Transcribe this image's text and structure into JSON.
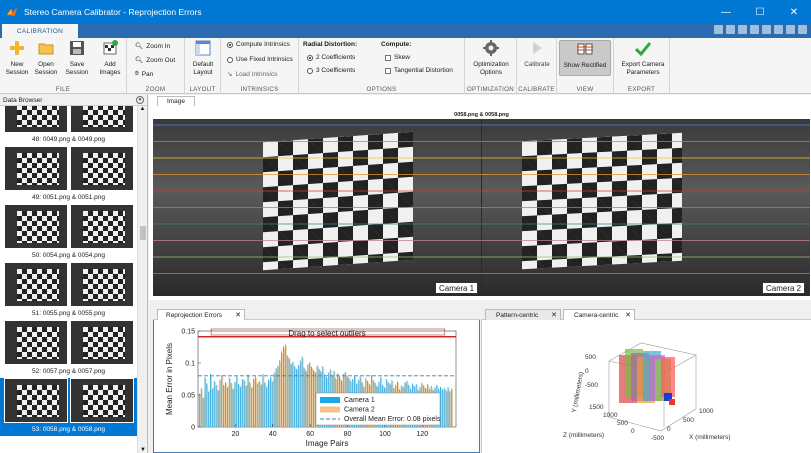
{
  "window": {
    "title": "Stereo Camera Calibrator - Reprojection Errors",
    "min": "—",
    "max": "☐",
    "close": "✕"
  },
  "ribbon_tab": "CALIBRATION",
  "file": {
    "new": "New Session",
    "open": "Open Session",
    "save": "Save Session",
    "add": "Add Images",
    "label": "FILE"
  },
  "zoom": {
    "in": "Zoom In",
    "out": "Zoom Out",
    "pan": "Pan",
    "label": "ZOOM"
  },
  "layout": {
    "default": "Default Layout",
    "label": "LAYOUT"
  },
  "intrinsics": {
    "compute": "Compute Intrinsics",
    "fixed": "Use Fixed Intrinsics",
    "load": "Load Intrinsics",
    "label": "INTRINSICS"
  },
  "options": {
    "radial": "Radial Distortion:",
    "c2": "2 Coefficients",
    "c3": "3 Coefficients",
    "compute": "Compute:",
    "skew": "Skew",
    "tangential": "Tangential Distortion",
    "label": "OPTIONS"
  },
  "optimization": {
    "btn": "Optimization Options",
    "label": "OPTIMIZATION"
  },
  "calibrate": {
    "btn": "Calibrate",
    "label": "CALIBRATE"
  },
  "view": {
    "btn": "Show Rectified",
    "label": "VIEW"
  },
  "export": {
    "btn": "Export Camera Parameters",
    "label": "EXPORT"
  },
  "data_browser": {
    "title": "Data Browser",
    "items": [
      "48: 0049.png & 0049.png",
      "49: 0051.png & 0051.png",
      "50: 0054.png & 0054.png",
      "51: 0055.png & 0055.png",
      "52: 0057.png & 0057.png",
      "53: 0058.png & 0058.png"
    ],
    "selected_index": 5
  },
  "image_view": {
    "tab": "Image",
    "pair_title": "0058.png & 0058.png",
    "cam1": "Camera 1",
    "cam2": "Camera 2"
  },
  "errors_tab": "Reprojection Errors",
  "right_tabs": [
    "Pattern-centric",
    "Camera-centric"
  ],
  "chart_data": {
    "type": "bar",
    "title": "",
    "drag_hint": "Drag to select outliers",
    "xlabel": "Image Pairs",
    "ylabel": "Mean Error in Pixels",
    "ylim": [
      0,
      0.15
    ],
    "xlim": [
      0,
      138
    ],
    "yticks": [
      "0",
      "0.05",
      "0.1",
      "0.15"
    ],
    "xticks": [
      "20",
      "40",
      "60",
      "80",
      "100",
      "120"
    ],
    "overall_mean": 0.08,
    "legend": [
      "Camera 1",
      "Camera 2",
      "Overall Mean Error: 0.08 pixels"
    ],
    "colors": {
      "camera1": "#1ea7e8",
      "camera2": "#f2c48c",
      "mean": "#3a7fb8",
      "outlier": "#d62728"
    },
    "outlier_threshold": 0.141,
    "series": [
      {
        "name": "Camera 1",
        "values": [
          0.052,
          0.061,
          0.045,
          0.078,
          0.068,
          0.055,
          0.083,
          0.06,
          0.072,
          0.065,
          0.058,
          0.074,
          0.081,
          0.066,
          0.07,
          0.062,
          0.077,
          0.069,
          0.059,
          0.071,
          0.08,
          0.067,
          0.063,
          0.075,
          0.073,
          0.064,
          0.082,
          0.07,
          0.061,
          0.076,
          0.079,
          0.068,
          0.072,
          0.066,
          0.083,
          0.069,
          0.062,
          0.074,
          0.078,
          0.071,
          0.085,
          0.092,
          0.096,
          0.105,
          0.118,
          0.126,
          0.129,
          0.112,
          0.108,
          0.099,
          0.102,
          0.095,
          0.091,
          0.097,
          0.104,
          0.11,
          0.093,
          0.088,
          0.098,
          0.101,
          0.094,
          0.089,
          0.086,
          0.096,
          0.091,
          0.087,
          0.095,
          0.082,
          0.078,
          0.085,
          0.09,
          0.081,
          0.088,
          0.076,
          0.084,
          0.079,
          0.073,
          0.083,
          0.086,
          0.08,
          0.077,
          0.072,
          0.075,
          0.081,
          0.068,
          0.074,
          0.079,
          0.07,
          0.063,
          0.076,
          0.072,
          0.067,
          0.081,
          0.073,
          0.069,
          0.064,
          0.071,
          0.078,
          0.066,
          0.062,
          0.075,
          0.07,
          0.068,
          0.073,
          0.061,
          0.066,
          0.071,
          0.059,
          0.065,
          0.063,
          0.07,
          0.072,
          0.066,
          0.06,
          0.068,
          0.064,
          0.067,
          0.058,
          0.063,
          0.069,
          0.065,
          0.061,
          0.067,
          0.06,
          0.064,
          0.058,
          0.062,
          0.066,
          0.06,
          0.063,
          0.059,
          0.061,
          0.057,
          0.062,
          0.056,
          0.06
        ]
      },
      {
        "name": "Camera 2",
        "values": [
          0.05,
          0.059,
          0.047,
          0.075,
          0.066,
          0.057,
          0.08,
          0.062,
          0.07,
          0.067,
          0.056,
          0.072,
          0.079,
          0.064,
          0.068,
          0.064,
          0.075,
          0.067,
          0.061,
          0.069,
          0.078,
          0.065,
          0.065,
          0.073,
          0.071,
          0.066,
          0.08,
          0.068,
          0.063,
          0.074,
          0.077,
          0.07,
          0.07,
          0.068,
          0.081,
          0.071,
          0.064,
          0.072,
          0.076,
          0.073,
          0.083,
          0.09,
          0.094,
          0.102,
          0.115,
          0.123,
          0.126,
          0.11,
          0.106,
          0.097,
          0.1,
          0.093,
          0.089,
          0.095,
          0.102,
          0.108,
          0.091,
          0.086,
          0.096,
          0.099,
          0.092,
          0.087,
          0.084,
          0.094,
          0.089,
          0.085,
          0.093,
          0.08,
          0.076,
          0.083,
          0.088,
          0.079,
          0.086,
          0.074,
          0.082,
          0.077,
          0.071,
          0.081,
          0.084,
          0.078,
          0.075,
          0.07,
          0.073,
          0.079,
          0.066,
          0.072,
          0.077,
          0.068,
          0.061,
          0.074,
          0.07,
          0.065,
          0.079,
          0.071,
          0.067,
          0.062,
          0.069,
          0.076,
          0.064,
          0.06,
          0.073,
          0.068,
          0.066,
          0.071,
          0.059,
          0.064,
          0.069,
          0.057,
          0.063,
          0.061,
          0.068,
          0.07,
          0.064,
          0.058,
          0.066,
          0.062,
          0.065,
          0.056,
          0.061,
          0.067,
          0.063,
          0.059,
          0.065,
          0.058,
          0.062,
          0.056,
          0.06,
          0.064,
          0.058,
          0.061,
          0.057,
          0.059,
          0.055,
          0.06,
          0.054,
          0.058
        ]
      }
    ]
  },
  "camera_centric": {
    "ylabel": "Y (millimeters)",
    "zlabel": "Z (millimeters)",
    "xlabel": "X (millimeters)",
    "y_ticks": [
      "500",
      "0",
      "-500"
    ],
    "z_ticks": [
      "1500",
      "1000",
      "500",
      "0"
    ],
    "x_ticks": [
      "1000",
      "500",
      "0",
      "-500"
    ]
  }
}
